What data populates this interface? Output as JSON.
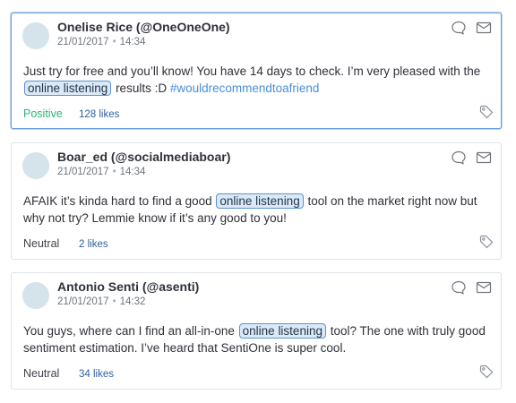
{
  "posts": [
    {
      "author": "Onelise Rice (@OneOneOne)",
      "date": "21/01/2017",
      "time": "14:34",
      "text_before": "Just try for free and you’ll know! You have 14 days to check. I’m very pleased with the ",
      "keyword": "online listening",
      "text_after": " results :D ",
      "hashtag": "#wouldrecommendtoafriend",
      "sentiment": "Positive",
      "likes": "128 likes",
      "selected": true
    },
    {
      "author": "Boar_ed (@socialmediaboar)",
      "date": "21/01/2017",
      "time": "14:34",
      "text_before": "AFAIK it’s kinda hard to find a good ",
      "keyword": "online listening",
      "text_after": " tool on the market right now but why not try? Lemmie know if it’s any good to you!",
      "hashtag": "",
      "sentiment": "Neutral",
      "likes": "2 likes",
      "selected": false
    },
    {
      "author": "Antonio Senti (@asenti)",
      "date": "21/01/2017",
      "time": "14:32",
      "text_before": "You guys, where can I find an all-in-one ",
      "keyword": "online listening",
      "text_after": " tool? The one with truly good sentiment estimation. I’ve heard that SentiOne is super cool.",
      "hashtag": "",
      "sentiment": "Neutral",
      "likes": "34 likes",
      "selected": false
    }
  ],
  "icons": {
    "reply": "speech-bubble-icon",
    "message": "envelope-icon",
    "tag": "tag-icon"
  },
  "colors": {
    "positive": "#2bb673",
    "neutral": "#3d4148",
    "highlight_border": "#5a93cf",
    "highlight_fill": "#dbe9f7",
    "hashtag": "#4a8fd6",
    "likes": "#2f5f9e",
    "selected_border": "#6a9fd8"
  }
}
